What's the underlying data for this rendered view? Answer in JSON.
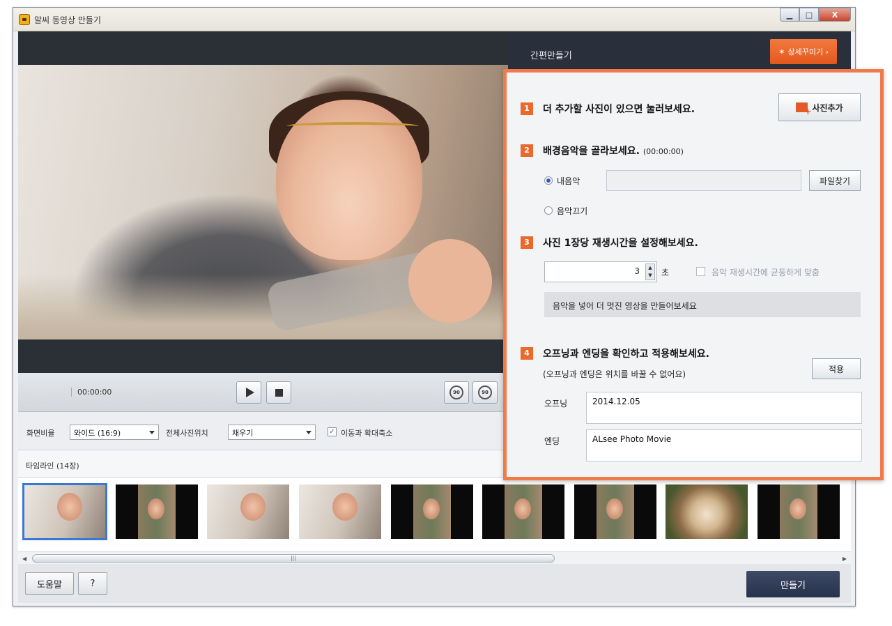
{
  "window": {
    "title": "알씨 동영상 만들기",
    "buttons": {
      "minimize": "▁",
      "maximize": "□",
      "close": "X"
    }
  },
  "player": {
    "timecode": "00:00:00",
    "rotate_left": "90",
    "rotate_right": "90"
  },
  "options": {
    "ratio_label": "화면비율",
    "ratio_value": "와이드 (16:9)",
    "position_label": "전체사진위치",
    "position_value": "채우기",
    "motion_label": "이동과 확대축소",
    "motion_checked": true
  },
  "timeline": {
    "title": "타임라인 (14장)",
    "thumbnails": [
      "light",
      "dark",
      "light",
      "light",
      "dark",
      "dark",
      "dark",
      "basket",
      "dark"
    ]
  },
  "footer": {
    "help": "도움말",
    "question": "?",
    "make": "만들기"
  },
  "right_panel": {
    "mode": "간편만들기",
    "decorate_button": "상세꾸미기 ›",
    "decorate_icon": "magic-wand",
    "step1": {
      "num": "1",
      "title": "더 추가할 사진이 있으면 눌러보세요.",
      "button": "사진추가"
    },
    "step2": {
      "num": "2",
      "title": "배경음악을 골라보세요.",
      "time": "(00:00:00)",
      "my_music": "내음악",
      "music_off": "음악끄기",
      "find_button": "파일찾기",
      "path_value": ""
    },
    "step3": {
      "num": "3",
      "title": "사진 1장당 재생시간을 설정해보세요.",
      "seconds_value": "3",
      "seconds_unit": "초",
      "sync_label": "음악 재생시간에 균등하게 맞춤",
      "info": "음악을 넣어 더 멋진 영상을 만들어보세요"
    },
    "step4": {
      "num": "4",
      "title": "오프닝과 엔딩을 확인하고 적용해보세요.",
      "subtitle": "(오프닝과 엔딩은 위치를 바꿀 수 없어요)",
      "apply_button": "적용",
      "opening_label": "오프닝",
      "opening_value": "2014.12.05",
      "ending_label": "엔딩",
      "ending_value": "ALsee Photo Movie"
    }
  },
  "colors": {
    "accent": "#ea6a2e",
    "panel_border": "#ef7a4a",
    "header_dark": "#2a2f3c",
    "make_button": "#2f3a55",
    "selection": "#3a78d6"
  }
}
